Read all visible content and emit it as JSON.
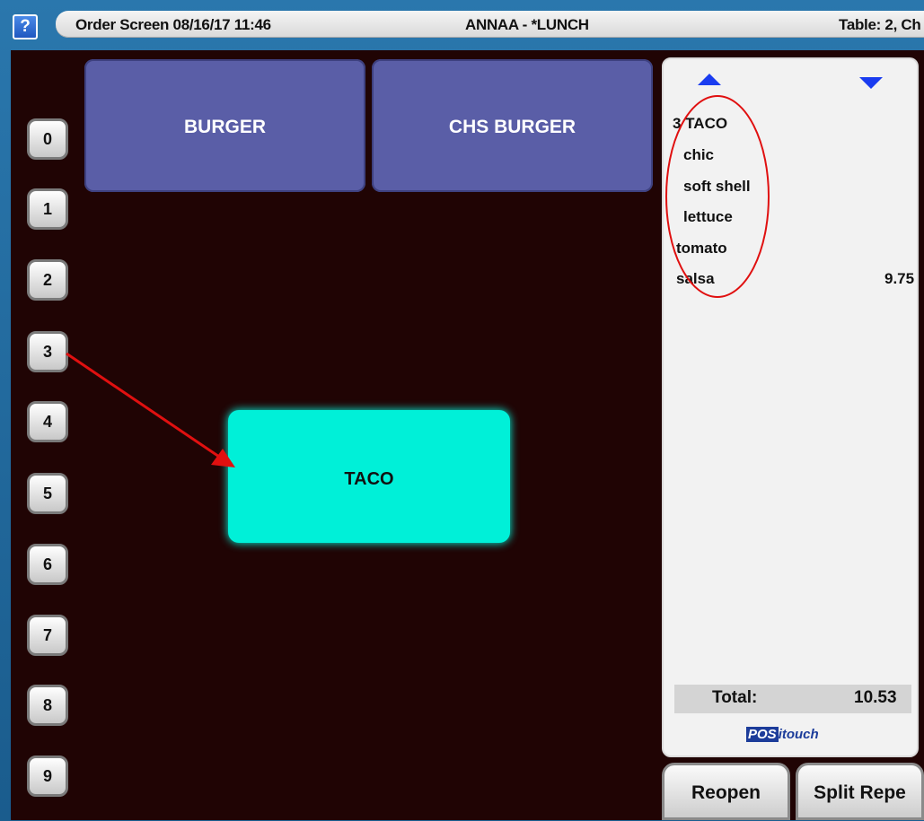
{
  "header": {
    "help_label": "?",
    "screen_title": "Order Screen 08/16/17 11:46",
    "server_meal": "ANNAA - *LUNCH",
    "table_info": "Table:  2, Ch"
  },
  "number_keys": [
    "0",
    "1",
    "2",
    "3",
    "4",
    "5",
    "6",
    "7",
    "8",
    "9"
  ],
  "menu_items": [
    {
      "label": "BURGER"
    },
    {
      "label": "CHS BURGER"
    },
    {
      "label": "TACO"
    }
  ],
  "order": {
    "lines": [
      {
        "text": "3 TACO",
        "price": ""
      },
      {
        "text": "chic",
        "price": ""
      },
      {
        "text": "soft shell",
        "price": ""
      },
      {
        "text": "lettuce",
        "price": ""
      },
      {
        "text": "tomato",
        "price": ""
      },
      {
        "text": "salsa",
        "price": "9.75"
      }
    ],
    "total_label": "Total:",
    "total_value": "10.53",
    "logo_pos": "POS",
    "logo_itouch": "itouch"
  },
  "buttons": {
    "reopen": "Reopen",
    "split_repeat": "Split Repe"
  },
  "colors": {
    "frame": "#1b5f91",
    "main_bg": "#200404",
    "item_bg": "#5a5ea7",
    "selected_item": "#00f0d8",
    "annotation_red": "#e01010",
    "scroll_arrow": "#1a3cf0"
  },
  "icons": {
    "scroll_up": "triangle-up-icon",
    "scroll_down": "triangle-down-icon",
    "help": "question-icon"
  }
}
